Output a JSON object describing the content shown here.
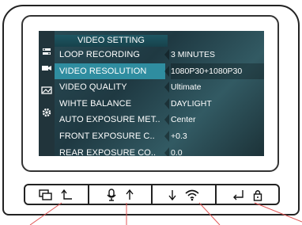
{
  "menu": {
    "title": "VIDEO SETTING",
    "rows": [
      {
        "label": "LOOP RECORDING",
        "value": "3 MINUTES"
      },
      {
        "label": "VIDEO RESOLUTION",
        "value": "1080P30+1080P30"
      },
      {
        "label": "VIDEO QUALITY",
        "value": "Ultimate"
      },
      {
        "label": "WIHTE BALANCE",
        "value": "DAYLIGHT"
      },
      {
        "label": "AUTO EXPOSURE MET..",
        "value": "Center"
      },
      {
        "label": "FRONT EXPOSURE C..",
        "value": "+0.3"
      },
      {
        "label": "REAR EXPOSURE CO..",
        "value": "0.0"
      }
    ],
    "selected_index": 1
  },
  "sidebar": {
    "icons": [
      "settings-icon",
      "video-camera-icon",
      "photo-icon",
      "gear-icon"
    ]
  },
  "buttons": [
    {
      "icons": [
        "screen-switch-icon",
        "arrow-up-turn-icon"
      ]
    },
    {
      "icons": [
        "microphone-icon",
        "arrow-up-icon"
      ]
    },
    {
      "icons": [
        "arrow-down-icon",
        "wifi-icon"
      ]
    },
    {
      "icons": [
        "enter-icon",
        "lock-icon"
      ]
    }
  ],
  "colors": {
    "screen_bg": "#1f3942",
    "title_bg": "#1e5763",
    "selected_bg": "#2f8da0",
    "text": "#ffffff",
    "callout_line": "#e05555"
  }
}
